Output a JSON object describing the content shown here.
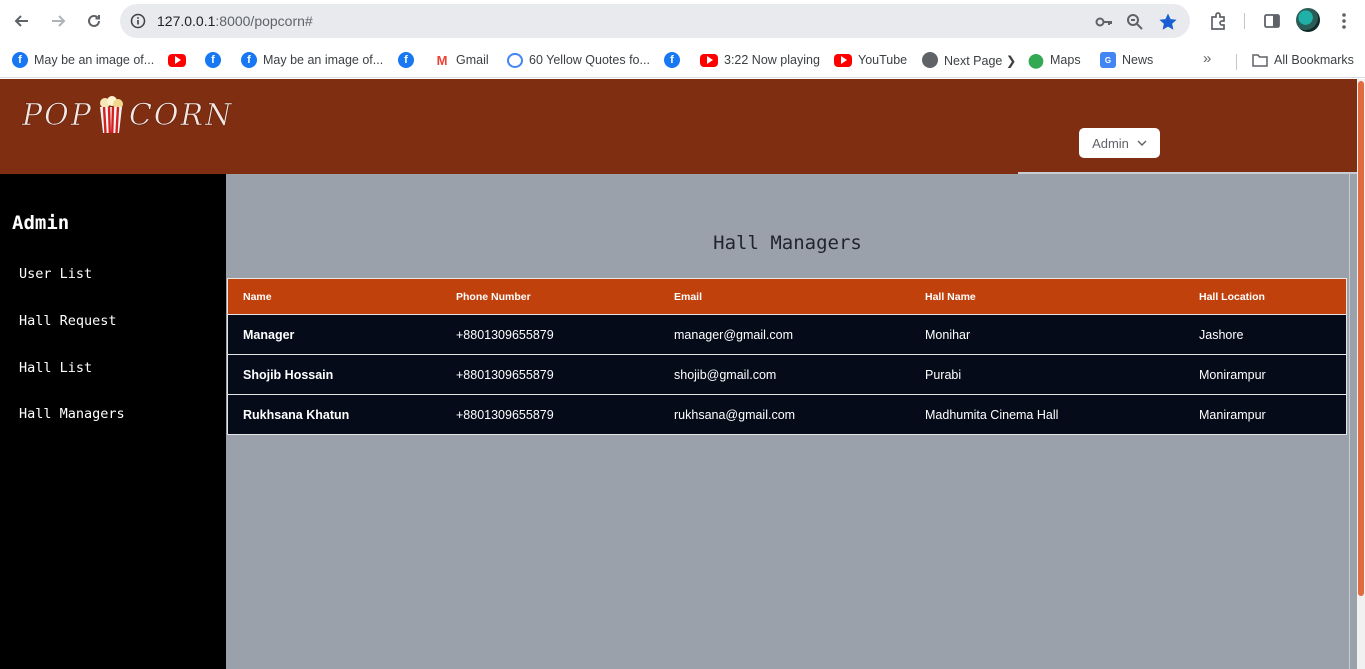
{
  "browser": {
    "url_host": "127.0.0.1",
    "url_rest": ":8000/popcorn#",
    "bookmarks": [
      {
        "label": "May be an image of...",
        "icon": "facebook-icon"
      },
      {
        "label": "",
        "icon": "youtube-icon"
      },
      {
        "label": "",
        "icon": "facebook-icon"
      },
      {
        "label": "May be an image of...",
        "icon": "facebook-icon"
      },
      {
        "label": "",
        "icon": "facebook-icon"
      },
      {
        "label": "Gmail",
        "icon": "gmail-icon"
      },
      {
        "label": "60 Yellow Quotes fo...",
        "icon": "google-icon"
      },
      {
        "label": "",
        "icon": "facebook-icon"
      },
      {
        "label": "3:22 Now playing",
        "icon": "youtube-icon"
      },
      {
        "label": "YouTube",
        "icon": "youtube-icon"
      },
      {
        "label": "Next Page ❯",
        "icon": "globe-icon"
      },
      {
        "label": "Maps",
        "icon": "maps-icon"
      },
      {
        "label": "News",
        "icon": "news-icon"
      }
    ],
    "all_bookmarks": "All Bookmarks"
  },
  "header": {
    "logo_left": "POP",
    "logo_right": "CORN",
    "admin_dropdown": "Admin"
  },
  "sidebar": {
    "title": "Admin",
    "items": [
      {
        "label": "User List"
      },
      {
        "label": "Hall Request"
      },
      {
        "label": "Hall List"
      },
      {
        "label": "Hall Managers"
      }
    ]
  },
  "main": {
    "title": "Hall Managers",
    "columns": [
      "Name",
      "Phone Number",
      "Email",
      "Hall Name",
      "Hall Location"
    ],
    "rows": [
      {
        "name": "Manager",
        "phone": "+8801309655879",
        "email": "manager@gmail.com",
        "hall": "Monihar",
        "location": "Jashore"
      },
      {
        "name": "Shojib Hossain",
        "phone": "+8801309655879",
        "email": "shojib@gmail.com",
        "hall": "Purabi",
        "location": "Monirampur"
      },
      {
        "name": "Rukhsana Khatun",
        "phone": "+8801309655879",
        "email": "rukhsana@gmail.com",
        "hall": "Madhumita Cinema Hall",
        "location": "Manirampur"
      }
    ]
  },
  "colors": {
    "header": "#7f2e12",
    "table_header": "#c1410c",
    "table_row": "#050b19",
    "content_bg": "#9ba1ab",
    "sidebar": "#000000"
  }
}
